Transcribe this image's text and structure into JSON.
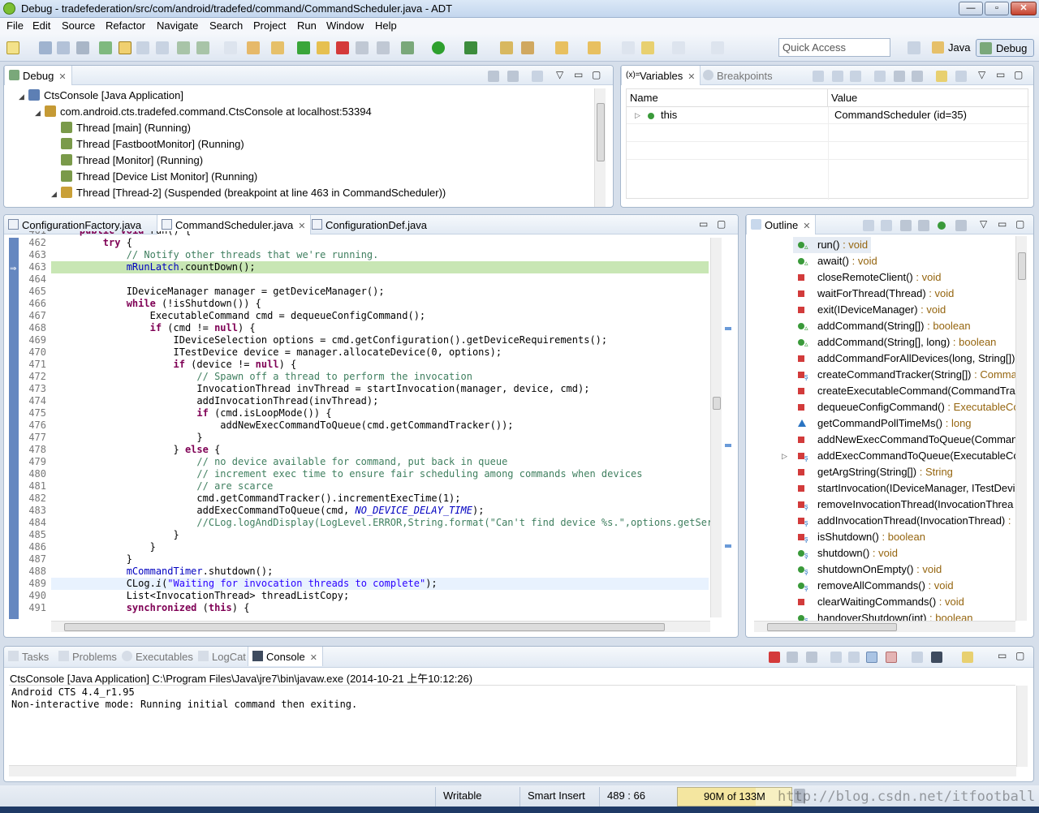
{
  "window": {
    "title": "Debug - tradefederation/src/com/android/tradefed/command/CommandScheduler.java - ADT",
    "minimize": "—",
    "maximize": "▫",
    "close": "✕"
  },
  "menu": [
    "File",
    "Edit",
    "Source",
    "Refactor",
    "Navigate",
    "Search",
    "Project",
    "Run",
    "Window",
    "Help"
  ],
  "toolbar": {
    "quick_access_placeholder": "Quick Access",
    "perspective_java": "Java",
    "perspective_debug": "Debug"
  },
  "debug_view": {
    "tab": "Debug",
    "tree": [
      {
        "label": "CtsConsole [Java Application]",
        "level": 0,
        "icon": "java-app-icon"
      },
      {
        "label": "com.android.cts.tradefed.command.CtsConsole at localhost:53394",
        "level": 1,
        "icon": "debug-target-icon"
      },
      {
        "label": "Thread [main] (Running)",
        "level": 2,
        "icon": "thread-icon"
      },
      {
        "label": "Thread [FastbootMonitor] (Running)",
        "level": 2,
        "icon": "thread-icon"
      },
      {
        "label": "Thread [Monitor] (Running)",
        "level": 2,
        "icon": "thread-icon"
      },
      {
        "label": "Thread [Device List Monitor] (Running)",
        "level": 2,
        "icon": "thread-icon"
      },
      {
        "label": "Thread [Thread-2] (Suspended (breakpoint at line 463 in CommandScheduler))",
        "level": 2,
        "icon": "thread-suspended-icon"
      }
    ]
  },
  "variables_view": {
    "tab_variables": "Variables",
    "tab_breakpoints": "Breakpoints",
    "col_name": "Name",
    "col_value": "Value",
    "rows": [
      {
        "name": "this",
        "value": "CommandScheduler  (id=35)"
      }
    ]
  },
  "editor": {
    "tabs": [
      "ConfigurationFactory.java",
      "CommandScheduler.java",
      "ConfigurationDef.java"
    ],
    "active_tab": 1,
    "lines": [
      {
        "n": "461",
        "html": "    <span class=\"kw\">public</span> <span class=\"kw\">void</span> run() {"
      },
      {
        "n": "462",
        "html": "        <span class=\"kw\">try</span> {"
      },
      {
        "n": "463",
        "html": "            <span class=\"cm\">// Notify other threads that we're running.</span>"
      },
      {
        "n": "463",
        "html": "            <span class=\"fd\">mRunLatch</span>.countDown();"
      },
      {
        "n": "464",
        "html": ""
      },
      {
        "n": "465",
        "html": "            IDeviceManager manager = getDeviceManager();"
      },
      {
        "n": "466",
        "html": "            <span class=\"kw\">while</span> (!isShutdown()) {"
      },
      {
        "n": "467",
        "html": "                ExecutableCommand cmd = dequeueConfigCommand();"
      },
      {
        "n": "468",
        "html": "                <span class=\"kw\">if</span> (cmd != <span class=\"kw\">null</span>) {"
      },
      {
        "n": "469",
        "html": "                    IDeviceSelection options = cmd.getConfiguration().getDeviceRequirements();"
      },
      {
        "n": "470",
        "html": "                    ITestDevice device = manager.allocateDevice(0, options);"
      },
      {
        "n": "471",
        "html": "                    <span class=\"kw\">if</span> (device != <span class=\"kw\">null</span>) {"
      },
      {
        "n": "472",
        "html": "                        <span class=\"cm\">// Spawn off a thread to perform the invocation</span>"
      },
      {
        "n": "473",
        "html": "                        InvocationThread invThread = startInvocation(manager, device, cmd);"
      },
      {
        "n": "474",
        "html": "                        addInvocationThread(invThread);"
      },
      {
        "n": "475",
        "html": "                        <span class=\"kw\">if</span> (cmd.isLoopMode()) {"
      },
      {
        "n": "476",
        "html": "                            addNewExecCommandToQueue(cmd.getCommandTracker());"
      },
      {
        "n": "477",
        "html": "                        }"
      },
      {
        "n": "478",
        "html": "                    } <span class=\"kw\">else</span> {"
      },
      {
        "n": "479",
        "html": "                        <span class=\"cm\">// no device available for command, put back in queue</span>"
      },
      {
        "n": "480",
        "html": "                        <span class=\"cm\">// increment exec time to ensure fair scheduling among commands when devices</span>"
      },
      {
        "n": "481",
        "html": "                        <span class=\"cm\">// are scarce</span>"
      },
      {
        "n": "482",
        "html": "                        cmd.getCommandTracker().incrementExecTime(1);"
      },
      {
        "n": "483",
        "html": "                        addExecCommandToQueue(cmd, <span class=\"fi\">NO_DEVICE_DELAY_TIME</span>);"
      },
      {
        "n": "484",
        "html": "                        <span class=\"cm\">//CLog.logAndDisplay(LogLevel.ERROR,String.format(\"Can't find device %s.\",options.getSerials</span>"
      },
      {
        "n": "485",
        "html": "                    }"
      },
      {
        "n": "486",
        "html": "                }"
      },
      {
        "n": "487",
        "html": "            }"
      },
      {
        "n": "488",
        "html": "            <span class=\"fd\">mCommandTimer</span>.shutdown();"
      },
      {
        "n": "489",
        "html": "            CLog.<span style=\"font-style:italic\">i</span>(<span class=\"st\">\"Waiting for invocation threads to complete\"</span>);"
      },
      {
        "n": "490",
        "html": "            List&lt;InvocationThread&gt; threadListCopy;"
      },
      {
        "n": "491",
        "html": "            <span class=\"kw\">synchronized</span> (<span class=\"kw\">this</span>) {"
      }
    ]
  },
  "outline": {
    "tab": "Outline",
    "items": [
      {
        "name": "run()",
        "type": " : void",
        "icon": "g",
        "badge": "▵"
      },
      {
        "name": "await()",
        "type": " : void",
        "icon": "g",
        "badge": "▵"
      },
      {
        "name": "closeRemoteClient()",
        "type": " : void",
        "icon": "r"
      },
      {
        "name": "waitForThread(Thread)",
        "type": " : void",
        "icon": "r"
      },
      {
        "name": "exit(IDeviceManager)",
        "type": " : void",
        "icon": "r"
      },
      {
        "name": "addCommand(String[])",
        "type": " : boolean",
        "icon": "g",
        "badge": "▵"
      },
      {
        "name": "addCommand(String[], long)",
        "type": " : boolean",
        "icon": "g",
        "badge": "▵"
      },
      {
        "name": "addCommandForAllDevices(long, String[])",
        "type": "",
        "icon": "r"
      },
      {
        "name": "createCommandTracker(String[])",
        "type": " : Comma",
        "icon": "r",
        "badge": "s"
      },
      {
        "name": "createExecutableCommand(CommandTrac",
        "type": "",
        "icon": "r"
      },
      {
        "name": "dequeueConfigCommand()",
        "type": " : ExecutableCo",
        "icon": "r"
      },
      {
        "name": "getCommandPollTimeMs()",
        "type": " : long",
        "icon": "t"
      },
      {
        "name": "addNewExecCommandToQueue(Comman",
        "type": "",
        "icon": "r"
      },
      {
        "name": "addExecCommandToQueue(ExecutableCo",
        "type": "",
        "icon": "r",
        "badge": "s",
        "expand": true
      },
      {
        "name": "getArgString(String[])",
        "type": " : String",
        "icon": "r"
      },
      {
        "name": "startInvocation(IDeviceManager, ITestDevi",
        "type": "",
        "icon": "r"
      },
      {
        "name": "removeInvocationThread(InvocationThrea",
        "type": "",
        "icon": "r",
        "badge": "s"
      },
      {
        "name": "addInvocationThread(InvocationThread)",
        "type": " :",
        "icon": "r",
        "badge": "s"
      },
      {
        "name": "isShutdown()",
        "type": " : boolean",
        "icon": "r",
        "badge": "s"
      },
      {
        "name": "shutdown()",
        "type": " : void",
        "icon": "g",
        "badge": "s"
      },
      {
        "name": "shutdownOnEmpty()",
        "type": " : void",
        "icon": "g",
        "badge": "s"
      },
      {
        "name": "removeAllCommands()",
        "type": " : void",
        "icon": "g",
        "badge": "s"
      },
      {
        "name": "clearWaitingCommands()",
        "type": " : void",
        "icon": "r"
      },
      {
        "name": "handoverShutdown(int)",
        "type": " : boolean",
        "icon": "g",
        "badge": "s"
      }
    ]
  },
  "bottom": {
    "tabs": [
      "Tasks",
      "Problems",
      "Executables",
      "LogCat",
      "Console"
    ],
    "active_tab": 4,
    "process_line": "CtsConsole [Java Application] C:\\Program Files\\Java\\jre7\\bin\\javaw.exe (2014-10-21 上午10:12:26)",
    "output": [
      "Android CTS 4.4_r1.95",
      "Non-interactive mode: Running initial command then exiting."
    ]
  },
  "status": {
    "writable": "Writable",
    "insert_mode": "Smart Insert",
    "position": "489 : 66",
    "heap": "90M of 133M",
    "watermark": "http://blog.csdn.net/itfootball"
  }
}
